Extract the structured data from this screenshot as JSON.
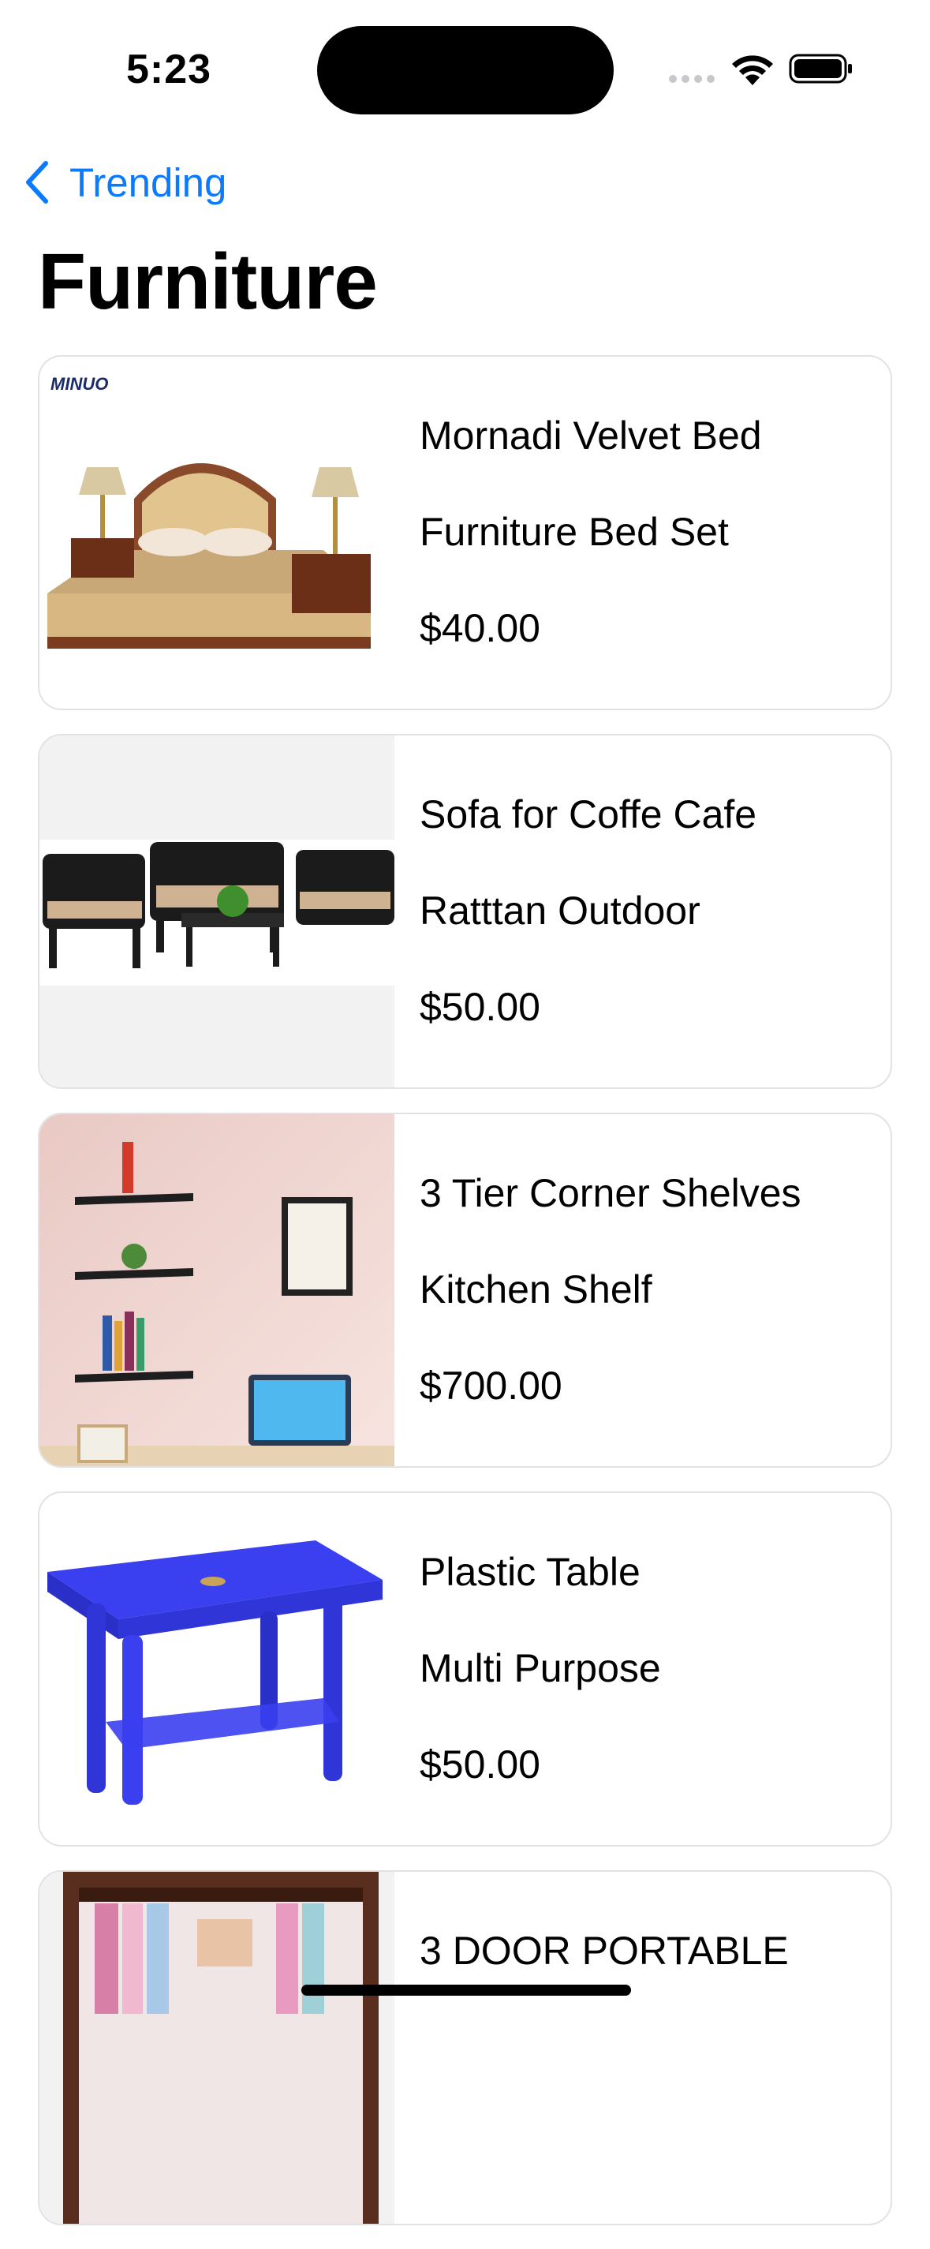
{
  "status_bar": {
    "time": "5:23"
  },
  "nav": {
    "back_label": "Trending"
  },
  "page": {
    "title": "Furniture"
  },
  "products": [
    {
      "name": "Mornadi Velvet Bed",
      "subtitle": "Furniture Bed Set",
      "price": "$40.00",
      "image": "bed-set-image",
      "brand_logo": "MINUO"
    },
    {
      "name": "Sofa for Coffe Cafe",
      "subtitle": "Ratttan Outdoor",
      "price": "$50.00",
      "image": "rattan-sofa-image"
    },
    {
      "name": "3 Tier Corner Shelves",
      "subtitle": "Kitchen Shelf",
      "price": "$700.00",
      "image": "corner-shelves-image"
    },
    {
      "name": "Plastic Table",
      "subtitle": "Multi Purpose",
      "price": "$50.00",
      "image": "plastic-table-image"
    },
    {
      "name": "3 DOOR PORTABLE",
      "subtitle": "",
      "price": "",
      "image": "wardrobe-image"
    }
  ],
  "colors": {
    "accent": "#0a7aff",
    "card_border": "#e2e2e6",
    "table_blue": "#3a3ff0"
  }
}
